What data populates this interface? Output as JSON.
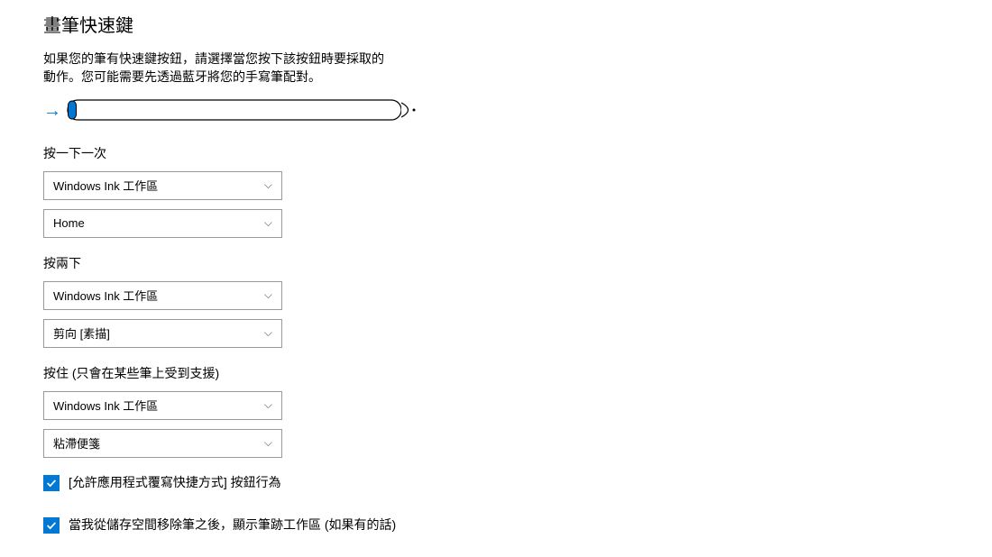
{
  "title": "畫筆快速鍵",
  "description": "如果您的筆有快速鍵按鈕，請選擇當您按下該按鈕時要採取的動作。您可能需要先透過藍牙將您的手寫筆配對。",
  "sections": {
    "singleClick": {
      "label": "按一下一次",
      "dropdown1": "Windows Ink 工作區",
      "dropdown2": "Home"
    },
    "doubleClick": {
      "label": "按兩下",
      "dropdown1": "Windows Ink 工作區",
      "dropdown2": "剪向 [素描]"
    },
    "pressHold": {
      "label": "按住 (只會在某些筆上受到支援)",
      "dropdown1": "Windows Ink 工作區",
      "dropdown2": "粘滯便箋"
    }
  },
  "checkboxes": {
    "allowOverride": "[允許應用程式覆寫快捷方式] 按鈕行為",
    "showInkWorkspace": "當我從儲存空間移除筆之後，顯示筆跡工作區 (如果有的話)"
  }
}
